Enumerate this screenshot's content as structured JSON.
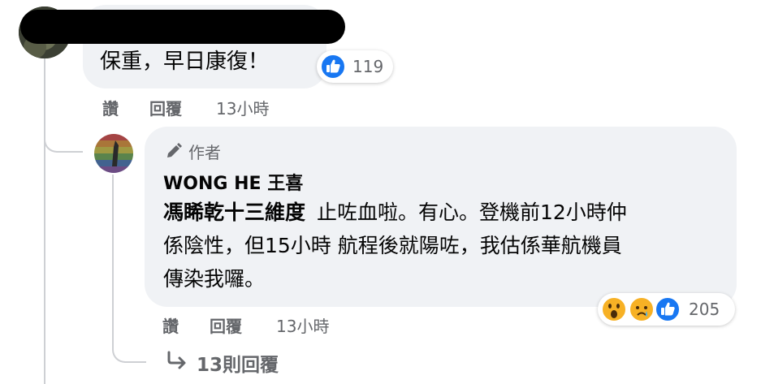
{
  "comment1": {
    "author": "",
    "text": "保重，早日康復！",
    "reaction_count": "119",
    "actions": {
      "like": "讚",
      "reply": "回覆",
      "time": "13小時"
    }
  },
  "reply1": {
    "author_badge": "作者",
    "author": "WONG HE 王喜",
    "mention": "馮睎乾十三維度",
    "text_line1": "止咗血啦。有心。登機前12小時仲",
    "text_line2": "係陰性，但15小時  航程後就陽咗，我估係華航機員",
    "text_line3": "傳染我囉。",
    "reaction_count": "205",
    "actions": {
      "like": "讚",
      "reply": "回覆",
      "time": "13小時"
    }
  },
  "more_replies": {
    "label": "13則回覆"
  },
  "colors": {
    "like_blue": "#1877f2",
    "bubble": "#f0f2f5",
    "secondary_text": "#65676b",
    "haha_yellow": "#f7b125"
  }
}
